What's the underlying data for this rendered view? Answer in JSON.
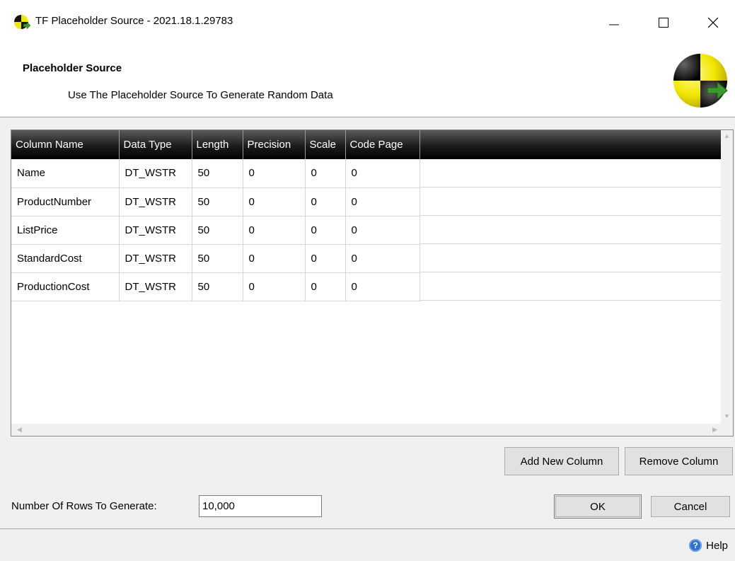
{
  "window": {
    "title": "TF Placeholder Source - 2021.18.1.29783",
    "minimize": "—",
    "maximize": "☐",
    "close": "✕"
  },
  "header": {
    "title": "Placeholder Source",
    "subtitle": "Use The Placeholder Source To Generate Random Data"
  },
  "grid": {
    "columns": [
      "Column Name",
      "Data Type",
      "Length",
      "Precision",
      "Scale",
      "Code Page"
    ],
    "rows": [
      [
        "Name",
        "DT_WSTR",
        "50",
        "0",
        "0",
        "0"
      ],
      [
        "ProductNumber",
        "DT_WSTR",
        "50",
        "0",
        "0",
        "0"
      ],
      [
        "ListPrice",
        "DT_WSTR",
        "50",
        "0",
        "0",
        "0"
      ],
      [
        "StandardCost",
        "DT_WSTR",
        "50",
        "0",
        "0",
        "0"
      ],
      [
        "ProductionCost",
        "DT_WSTR",
        "50",
        "0",
        "0",
        "0"
      ]
    ]
  },
  "buttons": {
    "add_column": "Add New Column",
    "remove_column": "Remove Column",
    "ok": "OK",
    "cancel": "Cancel"
  },
  "rows_to_generate": {
    "label": "Number Of Rows To Generate:",
    "value": "10,000"
  },
  "footer": {
    "help": "Help",
    "help_icon": "?"
  },
  "icons": {
    "app": "task-factory-icon",
    "logo": "task-factory-logo",
    "help": "help-icon"
  },
  "colors": {
    "grid_header_bg": "#000000",
    "grid_header_text": "#ffffff",
    "logo_yellow": "#f2e600",
    "logo_green": "#3a9a2a"
  }
}
